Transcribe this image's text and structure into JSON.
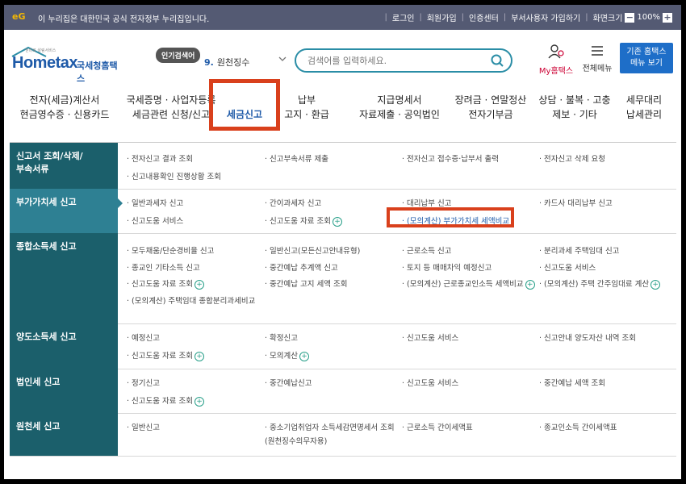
{
  "govbar": {
    "logo": "eG",
    "notice": "이 누리집은 대한민국 공식 전자정부 누리집입니다.",
    "login": "로그인",
    "signup": "회원가입",
    "cert": "인증센터",
    "dept_signup": "부서사용자 가입하기",
    "zoom_label": "화면크기",
    "zoom_minus": "−",
    "zoom_value": "100%",
    "zoom_plus": "+"
  },
  "header": {
    "logo_text": "Hometax",
    "logo_org": "국세청홈택스",
    "logo_tiny": "믿마로 살림서비스",
    "popular_label": "인기검색어",
    "popular_num": "9.",
    "popular_term": "원천징수",
    "search_placeholder": "검색어를 입력하세요.",
    "my_hometax": "My홈택스",
    "all_menu": "전체메뉴",
    "classic_line1": "기존 홈택스",
    "classic_line2": "메뉴 보기"
  },
  "gnb": [
    {
      "l1": "전자(세금)계산서",
      "l2": "현금영수증 · 신용카드"
    },
    {
      "l1": "국세증명 · 사업자등록",
      "l2": "세금관련 신청/신고"
    },
    {
      "l1": "세금신고",
      "l2": ""
    },
    {
      "l1": "납부",
      "l2": "고지 · 환급"
    },
    {
      "l1": "지급명세서",
      "l2": "자료제출 · 공익법인"
    },
    {
      "l1": "장려금 · 연말정산",
      "l2": "전자기부금"
    },
    {
      "l1": "상담 · 불복 · 고충",
      "l2": "제보 · 기타"
    },
    {
      "l1": "세무대리",
      "l2": "납세관리"
    }
  ],
  "rows": [
    {
      "cat": "신고서 조회/삭제/\n부속서류",
      "links": [
        "· 전자신고 결과 조회",
        "· 신고내용확인 진행상황 조회",
        "· 신고부속서류 제출",
        "· 전자신고 접수증·납부서 출력",
        "· 전자신고 삭제 요청"
      ]
    },
    {
      "cat": "부가가치세 신고",
      "links": [
        "· 일반과세자 신고",
        "· 신고도움 서비스",
        "· 간이과세자 신고",
        "· 신고도움 자료 조회",
        "· 대리납부 신고",
        "· (모의계산) 부가가치세 세액비교",
        "· 카드사 대리납부 신고"
      ]
    },
    {
      "cat": "종합소득세 신고",
      "links": [
        "· 모두채움/단순경비율 신고",
        "· 종교인 기타소득 신고",
        "· 신고도움 자료 조회",
        "· (모의계산) 주택임대 종합분리과세비교",
        "· 일반신고(모든신고안내유형)",
        "· 중간예납 추계액 신고",
        "· 중간예납 고지 세액 조회",
        "· 근로소득 신고",
        "· 토지 등 매매차익 예정신고",
        "· (모의계산) 근로종교인소득 세액비교",
        "· 분리과세 주택임대 신고",
        "· 신고도움 서비스",
        "· (모의계산) 주택 간주임대료 계산"
      ]
    },
    {
      "cat": "양도소득세 신고",
      "links": [
        "· 예정신고",
        "· 신고도움 자료 조회",
        "· 확정신고",
        "· 모의계산",
        "· 신고도움 서비스",
        "· 신고안내 양도자산 내역 조회"
      ]
    },
    {
      "cat": "법인세 신고",
      "links": [
        "· 정기신고",
        "· 신고도움 자료 조회",
        "· 중간예납신고",
        "· 신고도움 서비스",
        "· 중간예납 세액 조회"
      ]
    },
    {
      "cat": "원천세 신고",
      "links": [
        "· 일반신고",
        "· 중소기업취업자 소득세감면명세서 조회",
        "(원천징수의무자용)",
        "· 근로소득 간이세액표",
        "· 종교인소득 간이세액표"
      ]
    }
  ],
  "colors": {
    "highlight": "#d9401c",
    "category_bg": "#1b5f6b",
    "category_selected": "#2e8093",
    "brand": "#1e5aa8"
  }
}
